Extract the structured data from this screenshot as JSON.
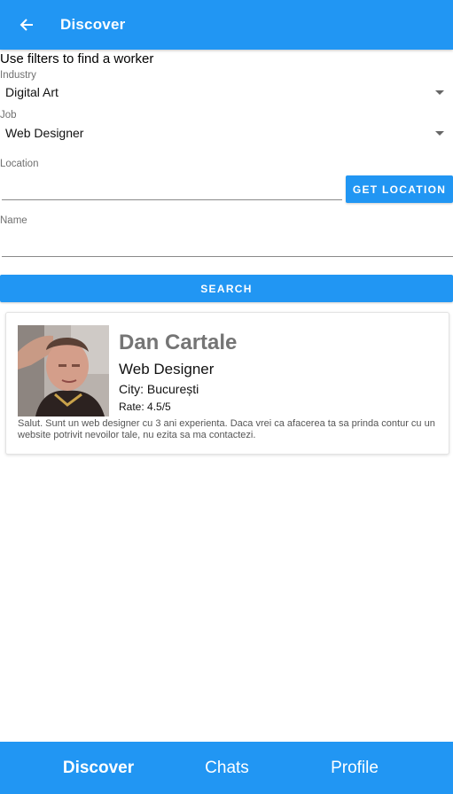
{
  "appbar": {
    "title": "Discover",
    "back_icon": "arrow-left-icon"
  },
  "filters": {
    "heading": "Use filters to find a worker",
    "industry": {
      "label": "Industry",
      "value": "Digital Art"
    },
    "job": {
      "label": "Job",
      "value": "Web Designer"
    },
    "location": {
      "label": "Location",
      "value": "",
      "button": "GET LOCATION"
    },
    "name": {
      "label": "Name",
      "value": ""
    },
    "search_button": "SEARCH"
  },
  "results": [
    {
      "name": "Dan Cartale",
      "job": "Web Designer",
      "city": "City: București",
      "rate": "Rate: 4.5/5",
      "description": "Salut. Sunt un web designer cu 3 ani experienta. Daca vrei ca afacerea ta sa prinda contur cu un website potrivit nevoilor tale, nu ezita sa ma contactezi."
    }
  ],
  "bottom_nav": {
    "items": [
      "Discover",
      "Chats",
      "Profile"
    ],
    "active": "Discover"
  },
  "colors": {
    "primary": "#2196f3",
    "name_gray": "#757575"
  }
}
